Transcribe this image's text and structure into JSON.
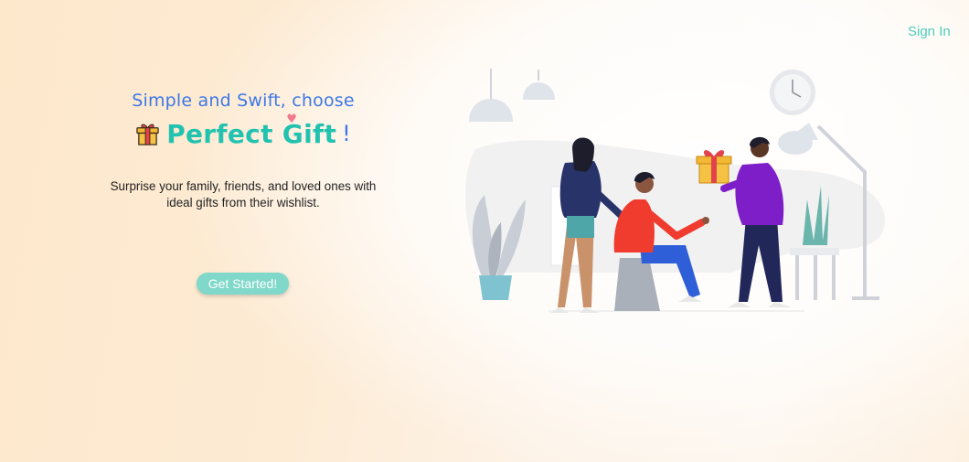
{
  "header": {
    "signin_label": "Sign In"
  },
  "hero": {
    "subtitle": "Simple and Swift, choose",
    "title": "Perfect Gift",
    "title_suffix": "!",
    "description_line1": "Surprise your family, friends, and loved ones with",
    "description_line2": "ideal gifts from their wishlist.",
    "cta_label": "Get Started!"
  },
  "colors": {
    "accent": "#22c2b0",
    "subtitle_blue": "#3d78e6",
    "button": "#7fd8c9",
    "heart": "#f07a8c"
  },
  "icons": {
    "title_icon": "gift-icon",
    "illustration": "gift-giving-illustration"
  }
}
